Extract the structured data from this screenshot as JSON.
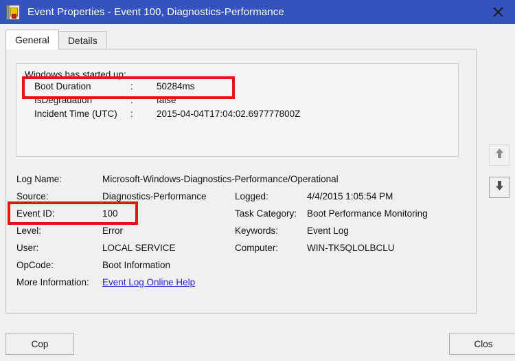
{
  "window": {
    "title": "Event Properties - Event 100, Diagnostics-Performance",
    "icon": "event-log-error-icon",
    "close_glyph": "✕",
    "titlebar_color": "#3453be"
  },
  "tabs": [
    {
      "label": "General",
      "active": true
    },
    {
      "label": "Details",
      "active": false
    }
  ],
  "description": {
    "intro": "Windows has started up:",
    "rows": [
      {
        "key": "Boot Duration",
        "colon": ":",
        "value": "50284ms"
      },
      {
        "key": "IsDegradation",
        "colon": ":",
        "value": "false"
      },
      {
        "key": "Incident Time (UTC)",
        "colon": ":",
        "value": "2015-04-04T17:04:02.697777800Z"
      }
    ]
  },
  "fields": {
    "log_name_label": "Log Name:",
    "log_name_value": "Microsoft-Windows-Diagnostics-Performance/Operational",
    "source_label": "Source:",
    "source_value": "Diagnostics-Performance",
    "logged_label": "Logged:",
    "logged_value": "4/4/2015 1:05:54 PM",
    "event_id_label": "Event ID:",
    "event_id_value": "100",
    "task_category_label": "Task Category:",
    "task_category_value": "Boot Performance Monitoring",
    "level_label": "Level:",
    "level_value": "Error",
    "keywords_label": "Keywords:",
    "keywords_value": "Event Log",
    "user_label": "User:",
    "user_value": "LOCAL SERVICE",
    "computer_label": "Computer:",
    "computer_value": "WIN-TK5QLOLBCLU",
    "opcode_label": "OpCode:",
    "opcode_value": "Boot Information",
    "more_info_label": "More Information:",
    "more_info_link": "Event Log Online Help"
  },
  "nav": {
    "up_label": "up-arrow",
    "down_label": "down-arrow"
  },
  "buttons": {
    "copy_label": "Cop",
    "close_label": "Clos"
  },
  "annotations": {
    "highlight_color": "#e81414",
    "boxes": [
      "boot-duration-row",
      "event-id-row"
    ]
  }
}
